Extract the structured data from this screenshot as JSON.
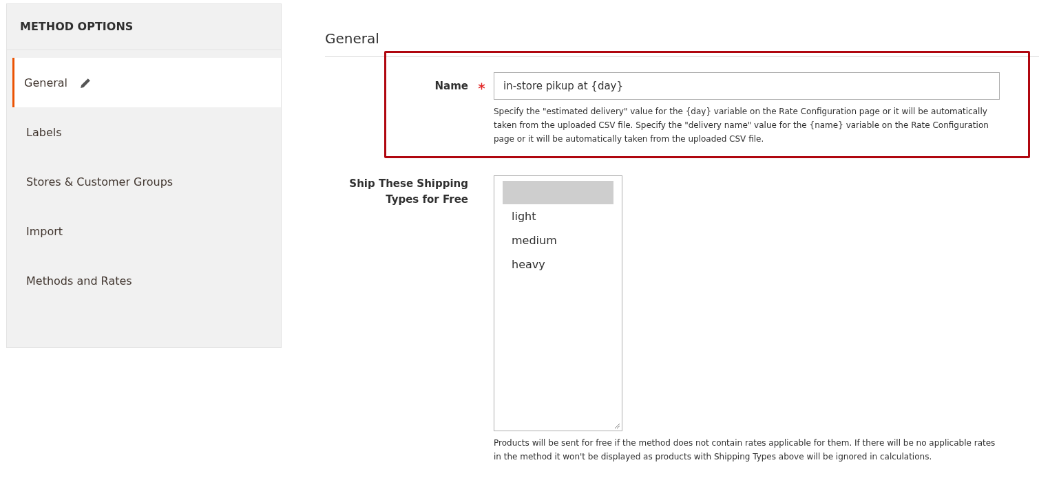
{
  "sidebar": {
    "title": "METHOD OPTIONS",
    "items": [
      {
        "label": "General",
        "selected": true,
        "edited": true
      },
      {
        "label": "Labels",
        "selected": false,
        "edited": false
      },
      {
        "label": "Stores & Customer Groups",
        "selected": false,
        "edited": false
      },
      {
        "label": "Import",
        "selected": false,
        "edited": false
      },
      {
        "label": "Methods and Rates",
        "selected": false,
        "edited": false
      }
    ]
  },
  "section": {
    "title": "General"
  },
  "name_field": {
    "label": "Name",
    "required": true,
    "value": "in-store pikup at {day}",
    "highlighted": true,
    "note": "Specify the \"estimated delivery\" value for the {day} variable on the Rate Configuration page or it will be automatically taken from the uploaded CSV file. Specify the \"delivery name\" value for the {name} variable on the Rate Configuration page or it will be automatically taken from the uploaded CSV file."
  },
  "shipping_types_field": {
    "label": "Ship These Shipping Types for Free",
    "blank_option": {
      "selected": true
    },
    "options": [
      {
        "label": "light",
        "selected": false
      },
      {
        "label": "medium",
        "selected": false
      },
      {
        "label": "heavy",
        "selected": false
      }
    ],
    "note": "Products will be sent for free if the method does not contain rates applicable for them. If there will be no applicable rates in the method it won't be displayed as products with Shipping Types above will be ignored in calculations."
  }
}
